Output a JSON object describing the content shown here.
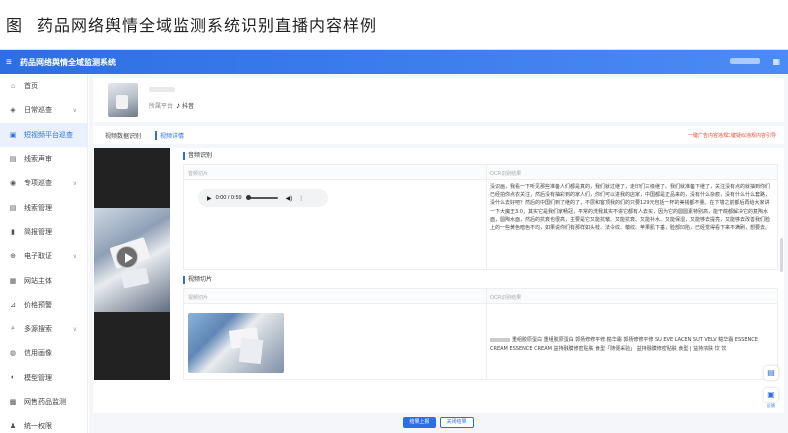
{
  "caption": {
    "fig": "图",
    "text": "药品网络舆情全域监测系统识别直播内容样例"
  },
  "topbar": {
    "title": "药品网络舆情全域监测系统"
  },
  "sidebar": {
    "items": [
      {
        "label": "首页",
        "icon": "home-icon",
        "glyph": "⌂",
        "chevron": false,
        "active": false
      },
      {
        "label": "日常巡查",
        "icon": "shield-icon",
        "glyph": "◈",
        "chevron": true,
        "active": false
      },
      {
        "label": "短视频平台巡查",
        "icon": "video-icon",
        "glyph": "▣",
        "chevron": false,
        "active": true
      },
      {
        "label": "线索声审",
        "icon": "flag-icon",
        "glyph": "▤",
        "chevron": false,
        "active": false
      },
      {
        "label": "专项巡查",
        "icon": "target-icon",
        "glyph": "◉",
        "chevron": true,
        "active": false
      },
      {
        "label": "线索管理",
        "icon": "list-icon",
        "glyph": "▤",
        "chevron": false,
        "active": false
      },
      {
        "label": "简报管理",
        "icon": "doc-icon",
        "glyph": "▮",
        "chevron": false,
        "active": false
      },
      {
        "label": "电子取证",
        "icon": "evidence-icon",
        "glyph": "⊕",
        "chevron": true,
        "active": false
      },
      {
        "label": "网站主体",
        "icon": "site-icon",
        "glyph": "▦",
        "chevron": false,
        "active": false
      },
      {
        "label": "价格预警",
        "icon": "price-icon",
        "glyph": "⊿",
        "chevron": false,
        "active": false
      },
      {
        "label": "多源搜索",
        "icon": "search-icon",
        "glyph": "⌕",
        "chevron": true,
        "active": false
      },
      {
        "label": "信用画像",
        "icon": "credit-icon",
        "glyph": "◍",
        "chevron": false,
        "active": false
      },
      {
        "label": "模型管理",
        "icon": "model-icon",
        "glyph": "◐",
        "chevron": false,
        "active": false
      },
      {
        "label": "网售药品监测",
        "icon": "pill-icon",
        "glyph": "▩",
        "chevron": false,
        "active": false
      },
      {
        "label": "统一权限",
        "icon": "user-icon",
        "glyph": "♟",
        "chevron": false,
        "active": false
      }
    ]
  },
  "account": {
    "platform_prefix": "所属平台",
    "platform_name": "抖音"
  },
  "tabs": {
    "recognition": "视频数据识别",
    "detail": "视频详情"
  },
  "actions": {
    "ad_warn": "一键广告内容违规",
    "mark": "二键疑似违规内容引导"
  },
  "audio_section": {
    "title": "音频识别",
    "col_left": "音频切片",
    "col_right": "OCR识别结果",
    "player": {
      "time": "0:00 / 0:59"
    },
    "ocr_text": "没识画，我看一下听见那些准备人们都是真的，我们就过继了，走印们三级继了。我们就准备下继了，关注没有点的就抽到你们已经拍你点衣关注，然后没有抽彩到的家人们，你们可以进我的店家，中国都是正品来的，没有什么杂痕，没有什么什么套路，没什么去好吧？然后的中国们到了继的了，不层和客顶我的们的只要129元包括一杯的美钱都不量。在下墙之前都后再给大家讲一下大魔王3.0，其实它是我们家畅冠，平常的洗我其实不讲它都有人去买，因为它的圆圆素特别高，能干皖都解决它的复陶水面，圆陶水面，然后的抗衰也很高，主要是它又能抗皱、又能抗衰、又能补水、又能保湿，又能够去提亮，又能够去改善我们脸上的一些黄色暗色不均，如果说你们有那样如头枝、法令纹、皱纹、苹果肌下垂，脸部凹陷，已经觉得看下来不满刷，想要去。"
  },
  "video_section": {
    "title": "视频切片",
    "col_left": "视频切片",
    "col_right": "OCR识别结果",
    "ocr_text": "重组胶原蛋白 重组胶原蛋白 郭扬修修平修 糙华霜 郭扬修修平修 SU EVE LACEN SUT VELV 糙华霜 ESSENCE CREAM ESSENCE CREAM 益持融膜修密贴肤 食型「随便采验」 益持融膜修密贴肤 食型 | 益持浓肤 饮 饮"
  },
  "footer": {
    "confirm": "结果上报",
    "cancel": "关闭结果"
  },
  "float": {
    "label": "反馈"
  },
  "colors": {
    "accent": "#2d6fe3",
    "warn": "#e24b3c"
  }
}
